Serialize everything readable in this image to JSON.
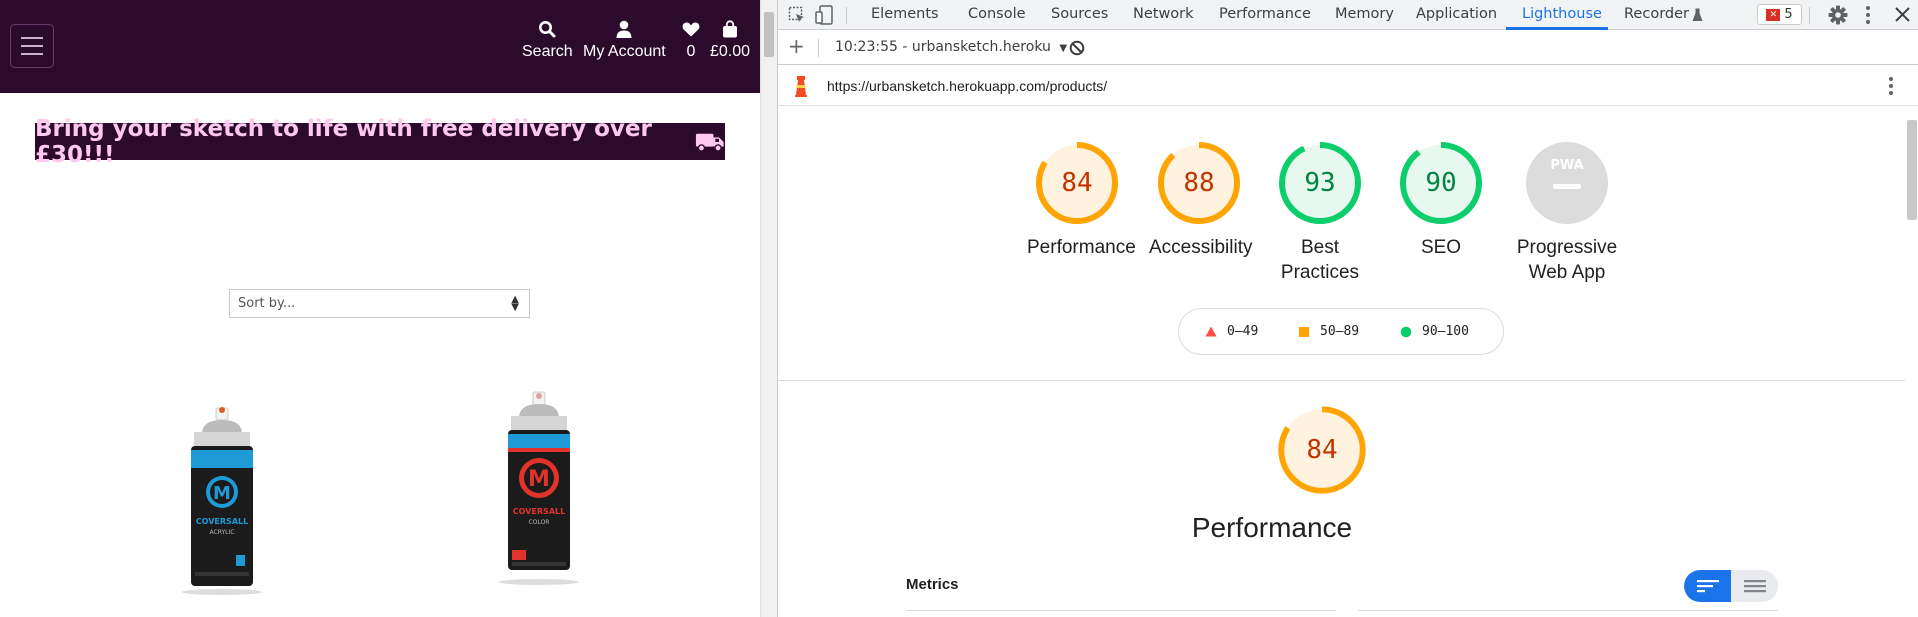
{
  "site": {
    "header": {
      "search_label": "Search",
      "account_label": "My Account",
      "wishlist_count": "0",
      "bag_total": "£0.00"
    },
    "banner_text": "Bring your sketch to life with free delivery over £30!!!",
    "sort_placeholder": "Sort by...",
    "products": [
      {
        "brand": "COVERSALL",
        "variant": "ACRYLIC",
        "accent": "#1e9bd7"
      },
      {
        "brand": "COVERSALL",
        "variant": "COLOR",
        "accent": "#e2332a"
      }
    ]
  },
  "devtools": {
    "tabs": [
      "Elements",
      "Console",
      "Sources",
      "Network",
      "Performance",
      "Memory",
      "Application",
      "Lighthouse",
      "Recorder"
    ],
    "active_tab": "Lighthouse",
    "error_count": "5",
    "report_selector": "10:23:55 - urbansketch.heroku",
    "url": "https://urbansketch.herokuapp.com/products/",
    "scores": [
      {
        "value": "84",
        "label": "Performance",
        "color": "#ffa400",
        "fraction": 0.84
      },
      {
        "value": "88",
        "label": "Accessibility",
        "color": "#ffa400",
        "fraction": 0.88
      },
      {
        "value": "93",
        "label": "Best Practices",
        "color": "#0cce6b",
        "fraction": 0.93
      },
      {
        "value": "90",
        "label": "SEO",
        "color": "#0cce6b",
        "fraction": 0.9
      },
      {
        "value": "PWA",
        "label": "Progressive Web App",
        "color": "#9e9e9e",
        "fraction": 0
      }
    ],
    "legend": [
      {
        "range": "0–49",
        "color": "#ff4e42",
        "shape": "triangle"
      },
      {
        "range": "50–89",
        "color": "#ffa400",
        "shape": "square"
      },
      {
        "range": "90–100",
        "color": "#0cce6b",
        "shape": "circle"
      }
    ],
    "section": {
      "score": "84",
      "title": "Performance",
      "metrics_label": "Metrics"
    }
  },
  "colors": {
    "site_header": "#2c0a2c",
    "banner_text": "#ffc8ee",
    "devtools_accent": "#1a73e8"
  }
}
